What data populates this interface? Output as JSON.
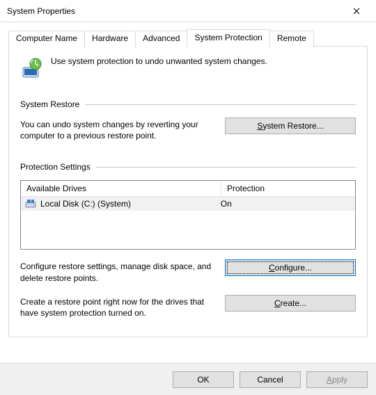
{
  "window": {
    "title": "System Properties"
  },
  "tabs": {
    "computer_name": "Computer Name",
    "hardware": "Hardware",
    "advanced": "Advanced",
    "system_protection": "System Protection",
    "remote": "Remote",
    "active": "system_protection"
  },
  "intro": {
    "text": "Use system protection to undo unwanted system changes."
  },
  "sections": {
    "restore": {
      "title": "System Restore",
      "desc": "You can undo system changes by reverting your computer to a previous restore point.",
      "button_prefix": "S",
      "button_rest": "ystem Restore..."
    },
    "protection": {
      "title": "Protection Settings",
      "columns": {
        "drive": "Available Drives",
        "protection": "Protection"
      },
      "rows": [
        {
          "name": "Local Disk (C:) (System)",
          "protection": "On"
        }
      ],
      "configure_desc": "Configure restore settings, manage disk space, and delete restore points.",
      "configure_prefix": "C",
      "configure_rest": "onfigure...",
      "create_desc": "Create a restore point right now for the drives that have system protection turned on.",
      "create_prefix": "C",
      "create_rest": "reate..."
    }
  },
  "buttons": {
    "ok": "OK",
    "cancel": "Cancel",
    "apply_prefix": "A",
    "apply_rest": "pply"
  }
}
